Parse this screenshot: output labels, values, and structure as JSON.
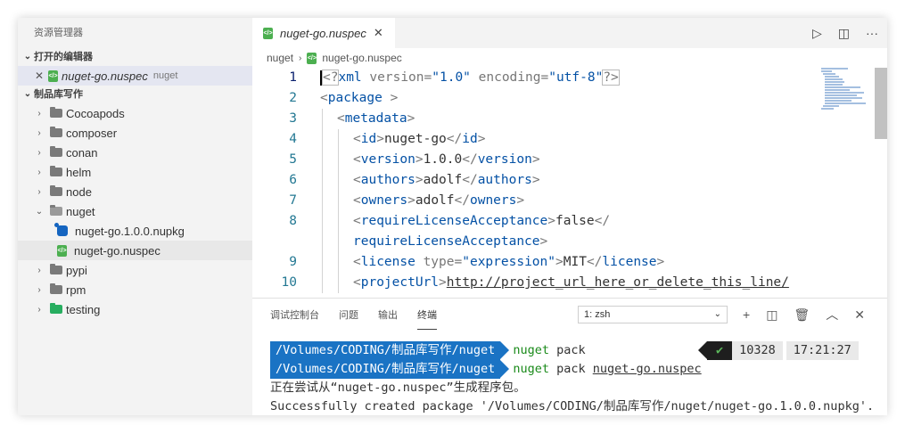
{
  "sidebar": {
    "title": "资源管理器",
    "open_editors_label": "打开的编辑器",
    "open_editor": {
      "name": "nuget-go.nuspec",
      "folder": "nuget"
    },
    "workspace_label": "制品库写作",
    "folders": [
      {
        "name": "Cocoapods"
      },
      {
        "name": "composer"
      },
      {
        "name": "conan"
      },
      {
        "name": "helm"
      },
      {
        "name": "node"
      },
      {
        "name": "nuget"
      }
    ],
    "nuget_files": [
      {
        "name": "nuget-go.1.0.0.nupkg"
      },
      {
        "name": "nuget-go.nuspec"
      }
    ],
    "folders_after": [
      {
        "name": "pypi"
      },
      {
        "name": "rpm"
      },
      {
        "name": "testing"
      }
    ]
  },
  "editor": {
    "tab_label": "nuget-go.nuspec",
    "breadcrumb": {
      "folder": "nuget",
      "file": "nuget-go.nuspec"
    },
    "line_numbers": [
      "1",
      "2",
      "3",
      "4",
      "5",
      "6",
      "7",
      "8",
      "9",
      "10"
    ],
    "code": {
      "l1": {
        "a": "<?",
        "tag": "xml",
        "attr1": " version",
        "eq1": "=",
        "v1": "\"1.0\"",
        "attr2": " encoding",
        "eq2": "=",
        "v2": "\"utf-8\"",
        "end": "?>"
      },
      "l2": {
        "open": "<",
        "tag": "package",
        "close": " >"
      },
      "l3": {
        "open": "<",
        "tag": "metadata",
        "close": ">"
      },
      "l4": {
        "o1": "<",
        "t1": "id",
        "c1": ">",
        "text": "nuget-go",
        "o2": "</",
        "t2": "id",
        "c2": ">"
      },
      "l5": {
        "o1": "<",
        "t1": "version",
        "c1": ">",
        "text": "1.0.0",
        "o2": "</",
        "t2": "version",
        "c2": ">"
      },
      "l6": {
        "o1": "<",
        "t1": "authors",
        "c1": ">",
        "text": "adolf",
        "o2": "</",
        "t2": "authors",
        "c2": ">"
      },
      "l7": {
        "o1": "<",
        "t1": "owners",
        "c1": ">",
        "text": "adolf",
        "o2": "</",
        "t2": "owners",
        "c2": ">"
      },
      "l8": {
        "o1": "<",
        "t1": "requireLicenseAcceptance",
        "c1": ">",
        "text": "false",
        "o2": "</"
      },
      "l8b": {
        "t2": "requireLicenseAcceptance",
        "c2": ">"
      },
      "l9": {
        "o1": "<",
        "t1": "license",
        "attr": " type",
        "eq": "=",
        "val": "\"expression\"",
        "c1": ">",
        "text": "MIT",
        "o2": "</",
        "t2": "license",
        "c2": ">"
      },
      "l10": {
        "o1": "<",
        "t1": "projectUrl",
        "c1": ">",
        "text": "http://project_url_here_or_delete_this_line/"
      }
    }
  },
  "panel": {
    "tabs": [
      "调试控制台",
      "问题",
      "输出",
      "终端"
    ],
    "shell": "1: zsh",
    "terminal": {
      "prompt_path": "/Volumes/CODING/制品库写作/nuget",
      "line1_cmd": "nuget",
      "line1_args": " pack",
      "line2_cmd": "nuget",
      "line2_args": " pack ",
      "line2_file": "nuget-go.nuspec",
      "status_check": "✔",
      "status_pid": "10328",
      "status_time": "17:21:27",
      "line3": "正在尝试从“nuget-go.nuspec”生成程序包。",
      "line4": "Successfully created package '/Volumes/CODING/制品库写作/nuget/nuget-go.1.0.0.nupkg'."
    }
  }
}
